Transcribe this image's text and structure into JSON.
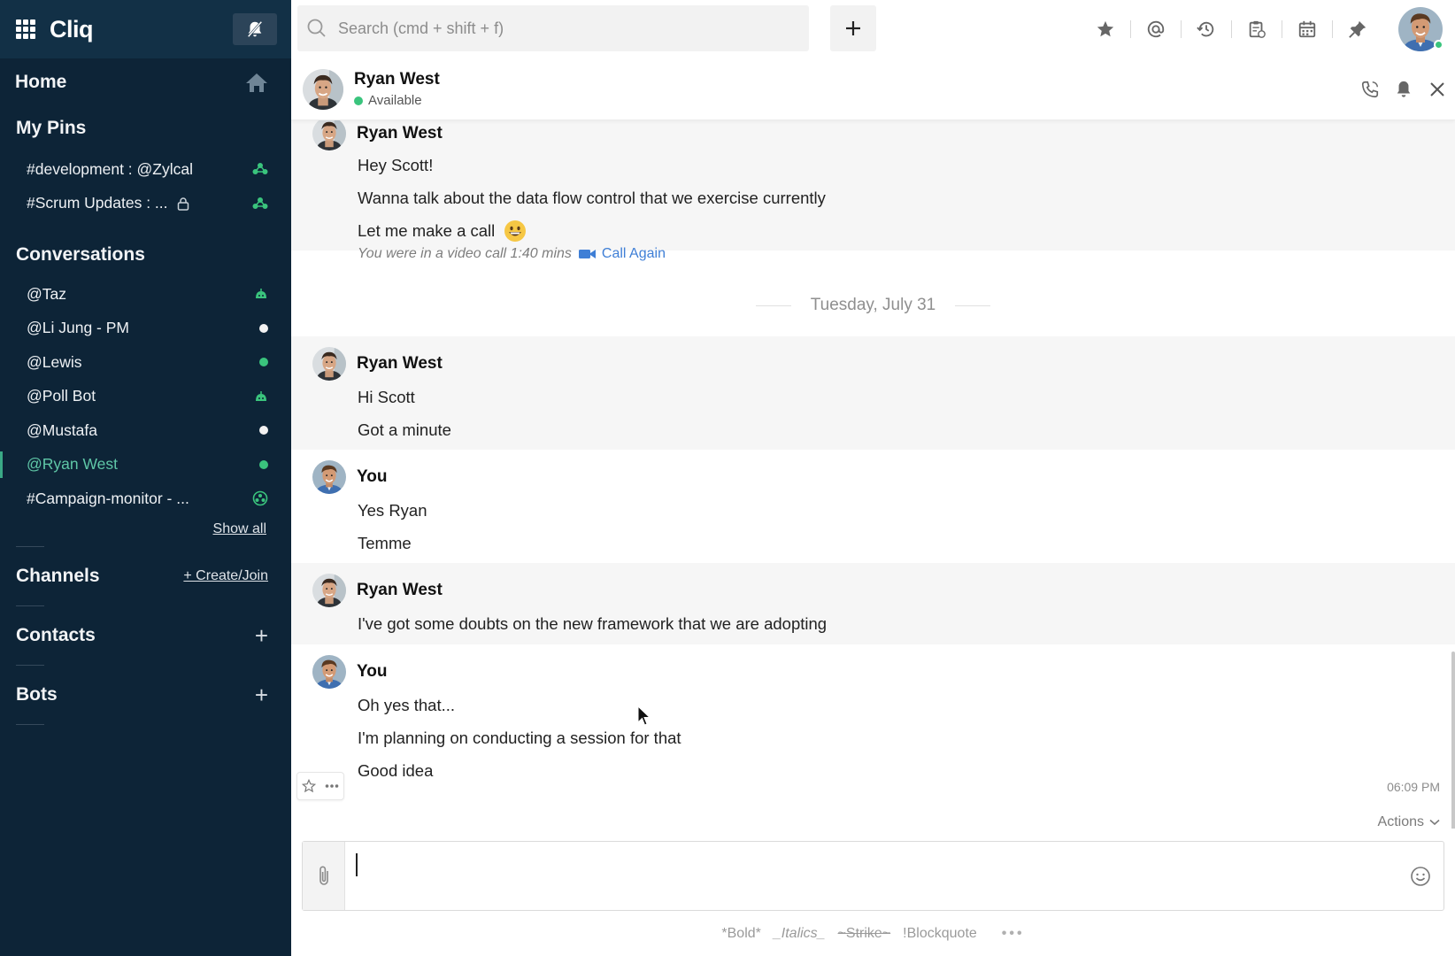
{
  "app": {
    "name": "Cliq"
  },
  "sidebar": {
    "home_label": "Home",
    "pins_title": "My Pins",
    "pins": [
      {
        "label": "#development : @Zylcal",
        "icon": "channel-people-icon",
        "locked": false
      },
      {
        "label": "#Scrum Updates : ...",
        "icon": "channel-people-icon",
        "locked": true
      }
    ],
    "conversations_title": "Conversations",
    "conversations": [
      {
        "label": "@Taz",
        "status": "bot-green"
      },
      {
        "label": "@Li Jung - PM",
        "status": "white"
      },
      {
        "label": "@Lewis",
        "status": "green"
      },
      {
        "label": "@Poll Bot",
        "status": "bot-green"
      },
      {
        "label": "@Mustafa",
        "status": "white"
      },
      {
        "label": "@Ryan West",
        "status": "green",
        "active": true
      },
      {
        "label": "#Campaign-monitor - ...",
        "status": "channel-green"
      }
    ],
    "show_all": "Show all",
    "channels_title": "Channels",
    "create_join": "+ Create/Join",
    "contacts_title": "Contacts",
    "bots_title": "Bots"
  },
  "topbar": {
    "search_placeholder": "Search (cmd + shift + f)",
    "icons": [
      "star-icon",
      "mention-icon",
      "history-icon",
      "clipboard-icon",
      "calendar-icon",
      "pin-icon"
    ]
  },
  "chat": {
    "contact_name": "Ryan West",
    "contact_status": "Available",
    "groups": [
      {
        "author": "Ryan West",
        "lines": [
          "Hey Scott!",
          "Wanna talk about the data flow control that we exercise currently",
          "Let me make a call"
        ]
      },
      {
        "author": "Ryan West",
        "lines": [
          "Hi Scott",
          "Got a minute"
        ]
      },
      {
        "author": "You",
        "lines": [
          "Yes Ryan",
          "Temme"
        ]
      },
      {
        "author": "Ryan West",
        "lines": [
          "I've got some doubts on the new framework that we are adopting"
        ]
      },
      {
        "author": "You",
        "lines": [
          "Oh yes that...",
          "I'm planning on conducting a session for that",
          "Good idea"
        ]
      }
    ],
    "call_info": "You were in a video call  1:40 mins",
    "call_again": "Call Again",
    "date_separator": "Tuesday, July 31",
    "last_timestamp": "06:09 PM",
    "actions_label": "Actions"
  },
  "composer": {
    "formats": [
      "*Bold*",
      "_Italics_",
      "~Strike~",
      "!Blockquote"
    ],
    "more": "•••"
  },
  "colors": {
    "sidebar_bg": "#0d2437",
    "accent_green": "#3ac47d",
    "link_blue": "#3f7fd6"
  }
}
